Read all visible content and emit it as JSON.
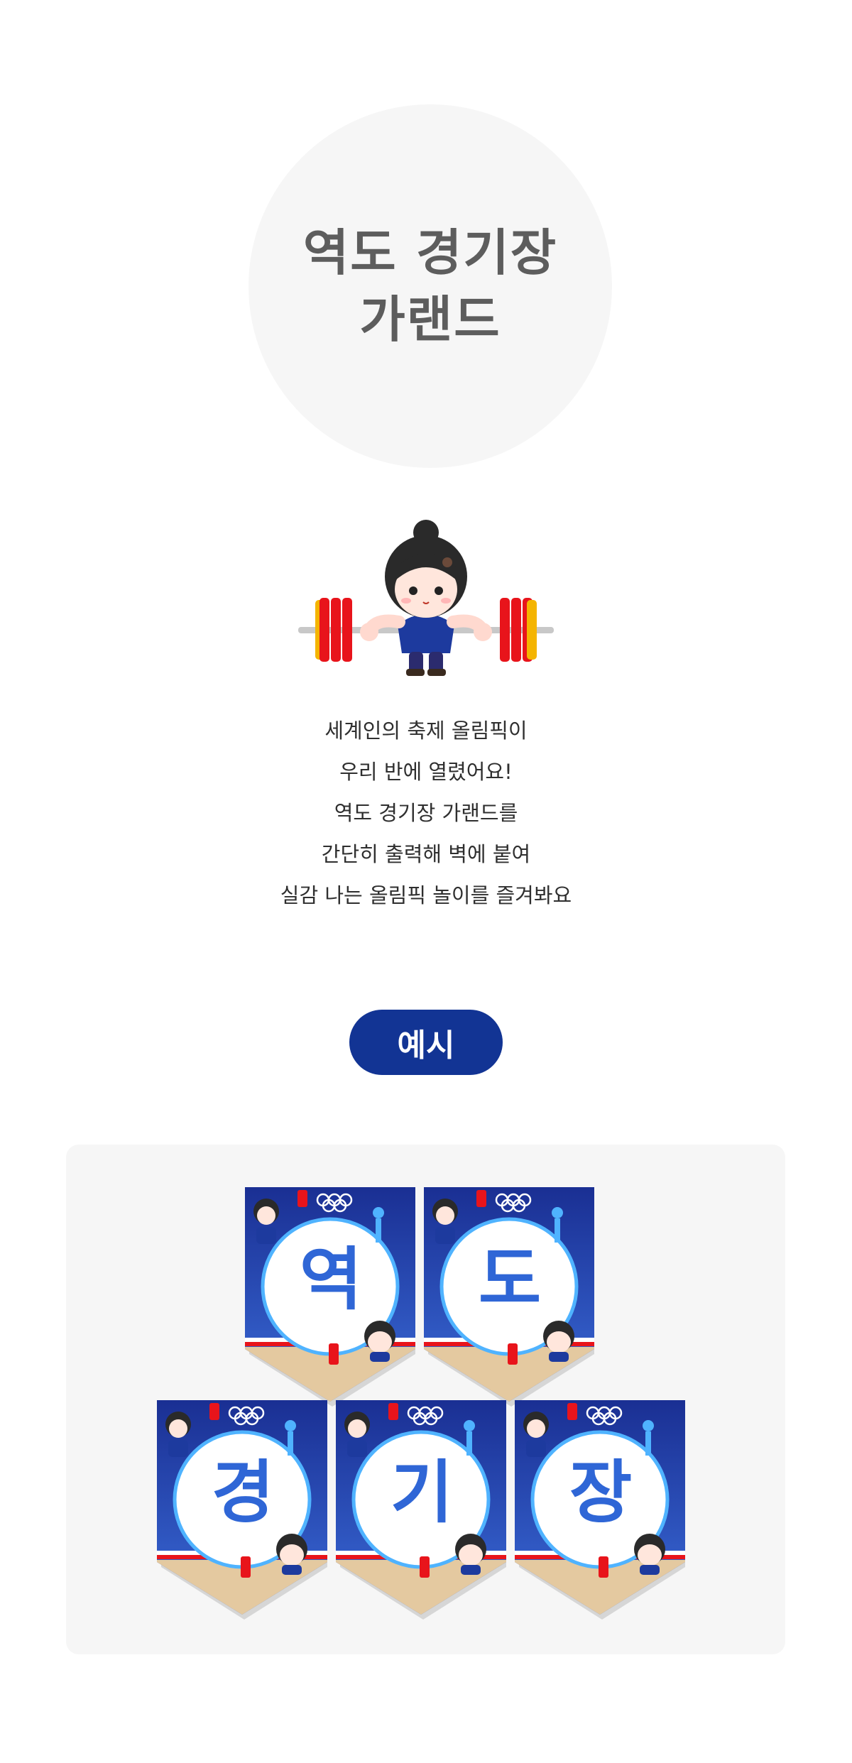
{
  "title": {
    "line1": "역도 경기장",
    "line2": "가랜드"
  },
  "description": [
    "세계인의 축제 올림픽이",
    "우리 반에 열렸어요!",
    "역도 경기장 가랜드를",
    "간단히 출력해 벽에 붙여",
    "실감 나는 올림픽 놀이를 즐겨봐요"
  ],
  "example_label": "예시",
  "pennants": [
    "역",
    "도",
    "경",
    "기",
    "장"
  ],
  "colors": {
    "accent": "#123494",
    "pennant_blue": "#1f3fa8",
    "letter": "#2f66d6",
    "plate_red": "#e8141b"
  },
  "icons": {
    "hero": "weightlifter-icon",
    "olympic": "olympic-rings-icon"
  }
}
